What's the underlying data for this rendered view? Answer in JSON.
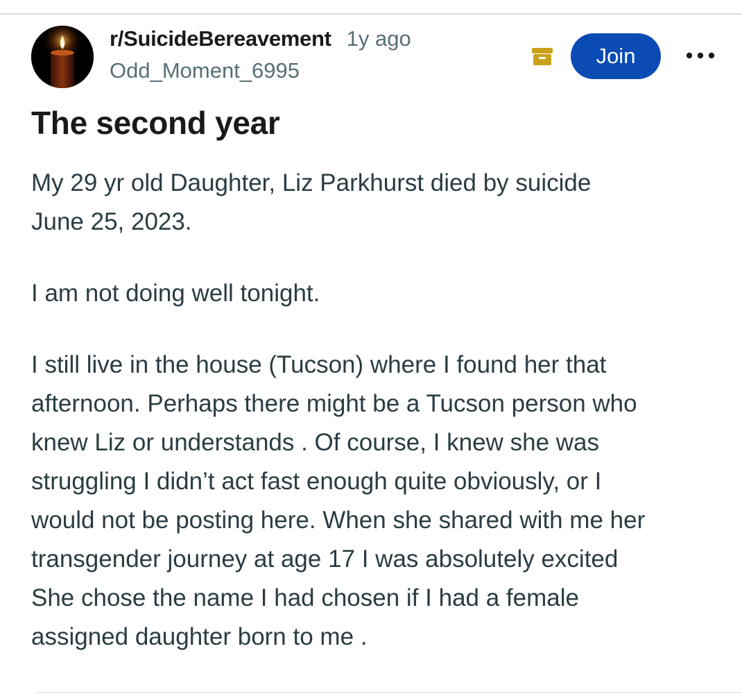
{
  "post": {
    "subreddit": "r/SuicideBereavement",
    "age": "1y ago",
    "author": "Odd_Moment_6995",
    "join_label": "Join",
    "title": "The second year",
    "paragraphs": [
      [
        "My 29 yr old Daughter, Liz Parkhurst died by suicide",
        "June 25, 2023."
      ],
      [
        "I am not doing well tonight."
      ],
      [
        "I still live in the house (Tucson) where I found her that",
        "afternoon. Perhaps there might be a Tucson person who",
        "knew Liz or understands . Of course, I knew she was",
        "struggling I didn’t act fast enough quite obviously, or I",
        "would not be posting here. When she shared with me her",
        "transgender journey at age 17 I was absolutely excited",
        "She chose the name I had chosen if I had a female",
        "assigned daughter born to me ."
      ]
    ]
  },
  "icons": {
    "avatar": "candle-icon",
    "archive": "archive-icon",
    "more": "more-options-icon"
  },
  "colors": {
    "join_button": "#0a4bb4",
    "archive_icon": "#c9a21a",
    "meta_text": "#576f76",
    "body_text": "#2a3c42"
  }
}
